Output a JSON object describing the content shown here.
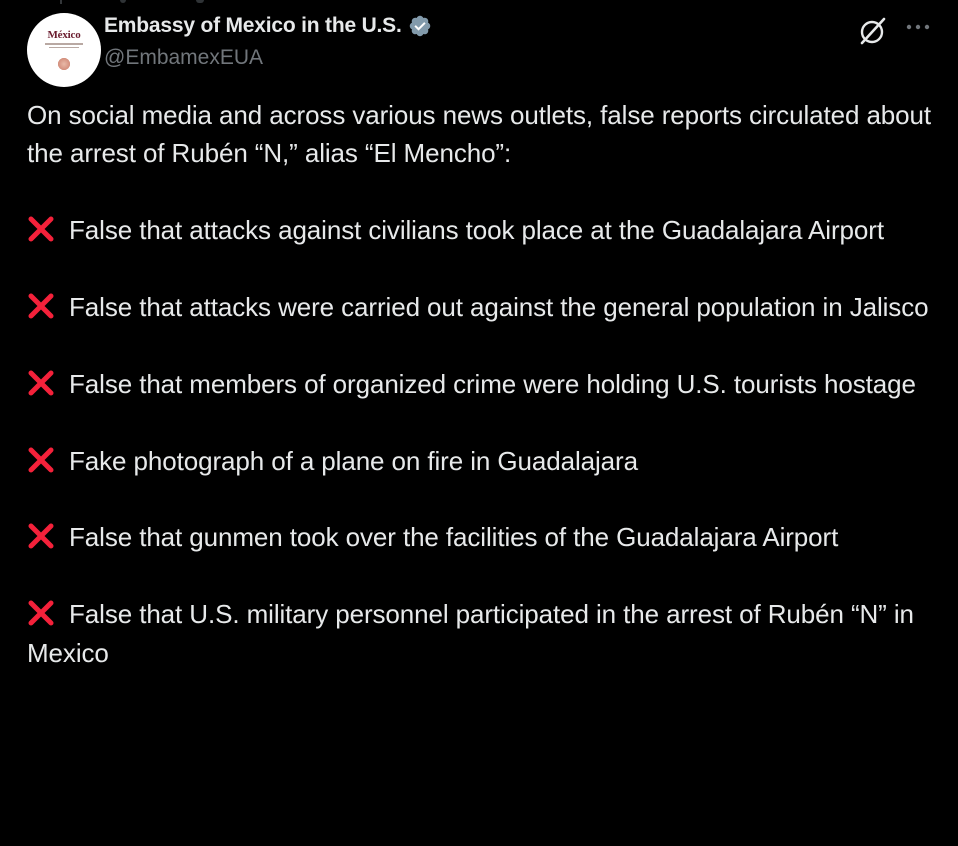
{
  "tweet": {
    "author": {
      "display_name": "Embassy of Mexico in the U.S.",
      "handle": "@EmbamexEUA",
      "avatar_text": "México",
      "verified_icon": "verified-badge-icon"
    },
    "actions": {
      "grok_icon": "grok-icon",
      "more_icon": "more-options-icon"
    },
    "intro": "On social media and across various news outlets, false reports circulated about the arrest of Rubén “N,” alias “El Mencho”:",
    "items": [
      "False that attacks against civilians took place at the Guadalajara Airport",
      "False that attacks were carried out against the general population in Jalisco",
      "False that members of organized crime were holding U.S. tourists hostage",
      "Fake photograph of a plane on fire in Guadalajara",
      "False that gunmen took over the facilities of the Guadalajara Airport",
      "False that U.S. military personnel participated in the arrest of Rubén “N” in Mexico"
    ],
    "bullet_icon": "cross-mark-icon"
  },
  "colors": {
    "background": "#000000",
    "text": "#e7e9ea",
    "secondary_text": "#71767b",
    "verified": "#829aab",
    "cross_mark": "#f4213a"
  }
}
